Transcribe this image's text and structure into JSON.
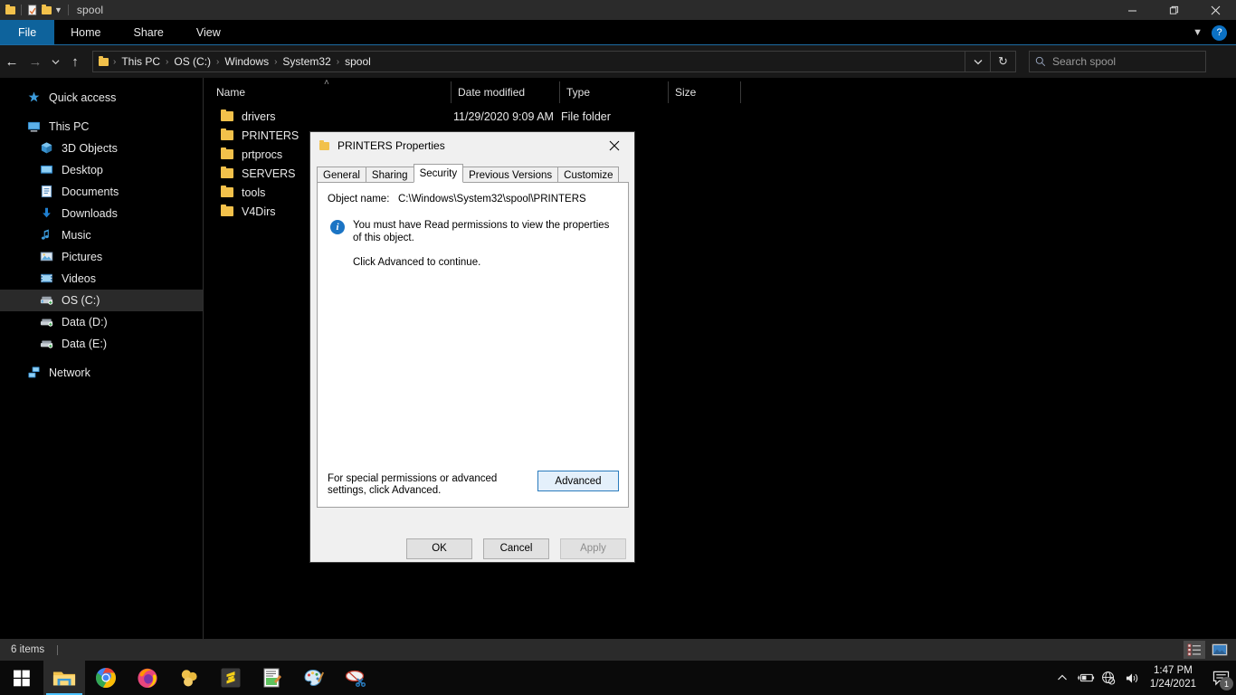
{
  "window": {
    "title": "spool",
    "quick_access_icons": [
      "folder-icon",
      "properties-icon",
      "new-folder-icon",
      "customize-qat-chevron-icon"
    ],
    "controls": {
      "minimize": "—",
      "maximize": "❐",
      "close": "✕"
    }
  },
  "ribbon": {
    "tabs": [
      {
        "label": "File",
        "active": true
      },
      {
        "label": "Home",
        "active": false
      },
      {
        "label": "Share",
        "active": false
      },
      {
        "label": "View",
        "active": false
      }
    ],
    "expand_icon": "chevron-down-icon",
    "help_label": "?",
    "accent_color": "#0e639c"
  },
  "address_bar": {
    "back_icon": "←",
    "forward_icon": "→",
    "recent_icon": "⌄",
    "up_icon": "↑",
    "breadcrumbs": [
      "This PC",
      "OS (C:)",
      "Windows",
      "System32",
      "spool"
    ],
    "separator": "›",
    "history_icon": "⌄",
    "refresh_icon": "↻"
  },
  "search": {
    "placeholder": "Search spool",
    "icon": "search-icon"
  },
  "sidebar": {
    "items": [
      {
        "label": "Quick access",
        "icon": "star-icon",
        "indent": false,
        "selected": false
      },
      {
        "label": "This PC",
        "icon": "monitor-icon",
        "indent": false,
        "selected": false
      },
      {
        "label": "3D Objects",
        "icon": "cube-icon",
        "indent": true,
        "selected": false
      },
      {
        "label": "Desktop",
        "icon": "desktop-icon",
        "indent": true,
        "selected": false
      },
      {
        "label": "Documents",
        "icon": "documents-icon",
        "indent": true,
        "selected": false
      },
      {
        "label": "Downloads",
        "icon": "download-icon",
        "indent": true,
        "selected": false
      },
      {
        "label": "Music",
        "icon": "music-note-icon",
        "indent": true,
        "selected": false
      },
      {
        "label": "Pictures",
        "icon": "picture-icon",
        "indent": true,
        "selected": false
      },
      {
        "label": "Videos",
        "icon": "video-icon",
        "indent": true,
        "selected": false
      },
      {
        "label": "OS (C:)",
        "icon": "drive-os-icon",
        "indent": true,
        "selected": true
      },
      {
        "label": "Data (D:)",
        "icon": "drive-icon",
        "indent": true,
        "selected": false
      },
      {
        "label": "Data (E:)",
        "icon": "drive-icon",
        "indent": true,
        "selected": false
      },
      {
        "label": "Network",
        "icon": "network-icon",
        "indent": false,
        "selected": false
      }
    ]
  },
  "filelist": {
    "columns": [
      "Name",
      "Date modified",
      "Type",
      "Size"
    ],
    "sort_indicator": "˄",
    "rows": [
      {
        "name": "drivers",
        "date": "11/29/2020 9:09 AM",
        "type": "File folder",
        "size": ""
      },
      {
        "name": "PRINTERS",
        "date": "",
        "type": "",
        "size": ""
      },
      {
        "name": "prtprocs",
        "date": "",
        "type": "",
        "size": ""
      },
      {
        "name": "SERVERS",
        "date": "",
        "type": "",
        "size": ""
      },
      {
        "name": "tools",
        "date": "",
        "type": "",
        "size": ""
      },
      {
        "name": "V4Dirs",
        "date": "",
        "type": "",
        "size": ""
      }
    ]
  },
  "statusbar": {
    "item_count": "6 items",
    "view_details_icon": "details-view-icon",
    "view_thumbnails_icon": "large-icons-view-icon"
  },
  "dialog": {
    "title": "PRINTERS Properties",
    "icon": "folder-icon",
    "close_icon": "✕",
    "tabs": [
      {
        "label": "General",
        "active": false
      },
      {
        "label": "Sharing",
        "active": false
      },
      {
        "label": "Security",
        "active": true
      },
      {
        "label": "Previous Versions",
        "active": false
      },
      {
        "label": "Customize",
        "active": false
      }
    ],
    "object_name_label": "Object name:",
    "object_name_value": "C:\\Windows\\System32\\spool\\PRINTERS",
    "info_icon": "info-icon",
    "info_text": "You must have Read permissions to view the properties of this object.",
    "advise_text": "Click Advanced to continue.",
    "bottom_hint": "For special permissions or advanced settings, click Advanced.",
    "advanced_label": "Advanced",
    "ok_label": "OK",
    "cancel_label": "Cancel",
    "apply_label": "Apply",
    "apply_disabled": true
  },
  "taskbar": {
    "start_icon": "windows-logo-icon",
    "apps": [
      {
        "name": "file-explorer",
        "active": true
      },
      {
        "name": "google-chrome",
        "active": false
      },
      {
        "name": "mozilla-firefox",
        "active": false
      },
      {
        "name": "mysql-workbench",
        "active": false
      },
      {
        "name": "sublime-text",
        "active": false
      },
      {
        "name": "notepad-plus-plus",
        "active": false
      },
      {
        "name": "paint",
        "active": false
      },
      {
        "name": "snipping-tool",
        "active": false
      }
    ],
    "tray": {
      "show_hidden_icon": "∧",
      "battery_icon": "battery-charging-icon",
      "network_icon": "globe-no-internet-icon",
      "volume_icon": "speaker-icon",
      "time": "1:47 PM",
      "date": "1/24/2021",
      "notification_icon": "action-center-icon",
      "notification_count": "1"
    }
  }
}
